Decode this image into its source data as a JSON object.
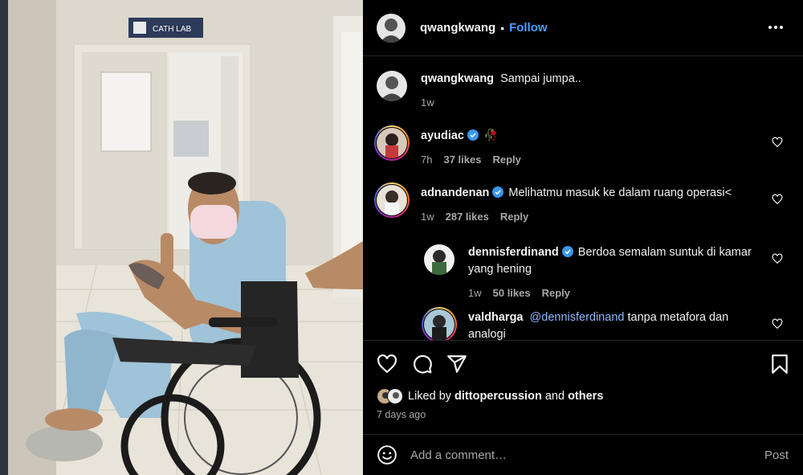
{
  "photo": {
    "sign_text": "CATH LAB"
  },
  "header": {
    "username": "qwangkwang",
    "separator": "•",
    "follow_label": "Follow",
    "more_icon": "more-horizontal-icon"
  },
  "caption": {
    "username": "qwangkwang",
    "text": "Sampai jumpa..",
    "time": "1w"
  },
  "comments": [
    {
      "username": "ayudiac",
      "verified": true,
      "text": "🥀",
      "time": "7h",
      "likes": "37 likes",
      "reply": "Reply"
    },
    {
      "username": "adnandenan",
      "verified": true,
      "text": "Melihatmu masuk ke dalam ruang operasi<",
      "time": "1w",
      "likes": "287 likes",
      "reply": "Reply"
    },
    {
      "username": "dennisferdinand",
      "verified": true,
      "text": "Berdoa semalam suntuk di kamar yang hening",
      "time": "1w",
      "likes": "50 likes",
      "reply": "Reply"
    },
    {
      "username": "valdharga",
      "verified": false,
      "mention": "@dennisferdinand",
      "text": "tanpa metafora dan analogi"
    }
  ],
  "actions": {
    "like_icon": "heart-icon",
    "comment_icon": "comment-icon",
    "share_icon": "share-icon",
    "save_icon": "bookmark-icon"
  },
  "likes": {
    "prefix": "Liked by",
    "user": "dittopercussion",
    "and": "and",
    "others": "others"
  },
  "posted": "7 days ago",
  "add_comment": {
    "placeholder": "Add a comment…",
    "post_label": "Post"
  },
  "colors": {
    "accent": "#4a9cff",
    "verified": "#3897f0",
    "background": "#000000"
  }
}
